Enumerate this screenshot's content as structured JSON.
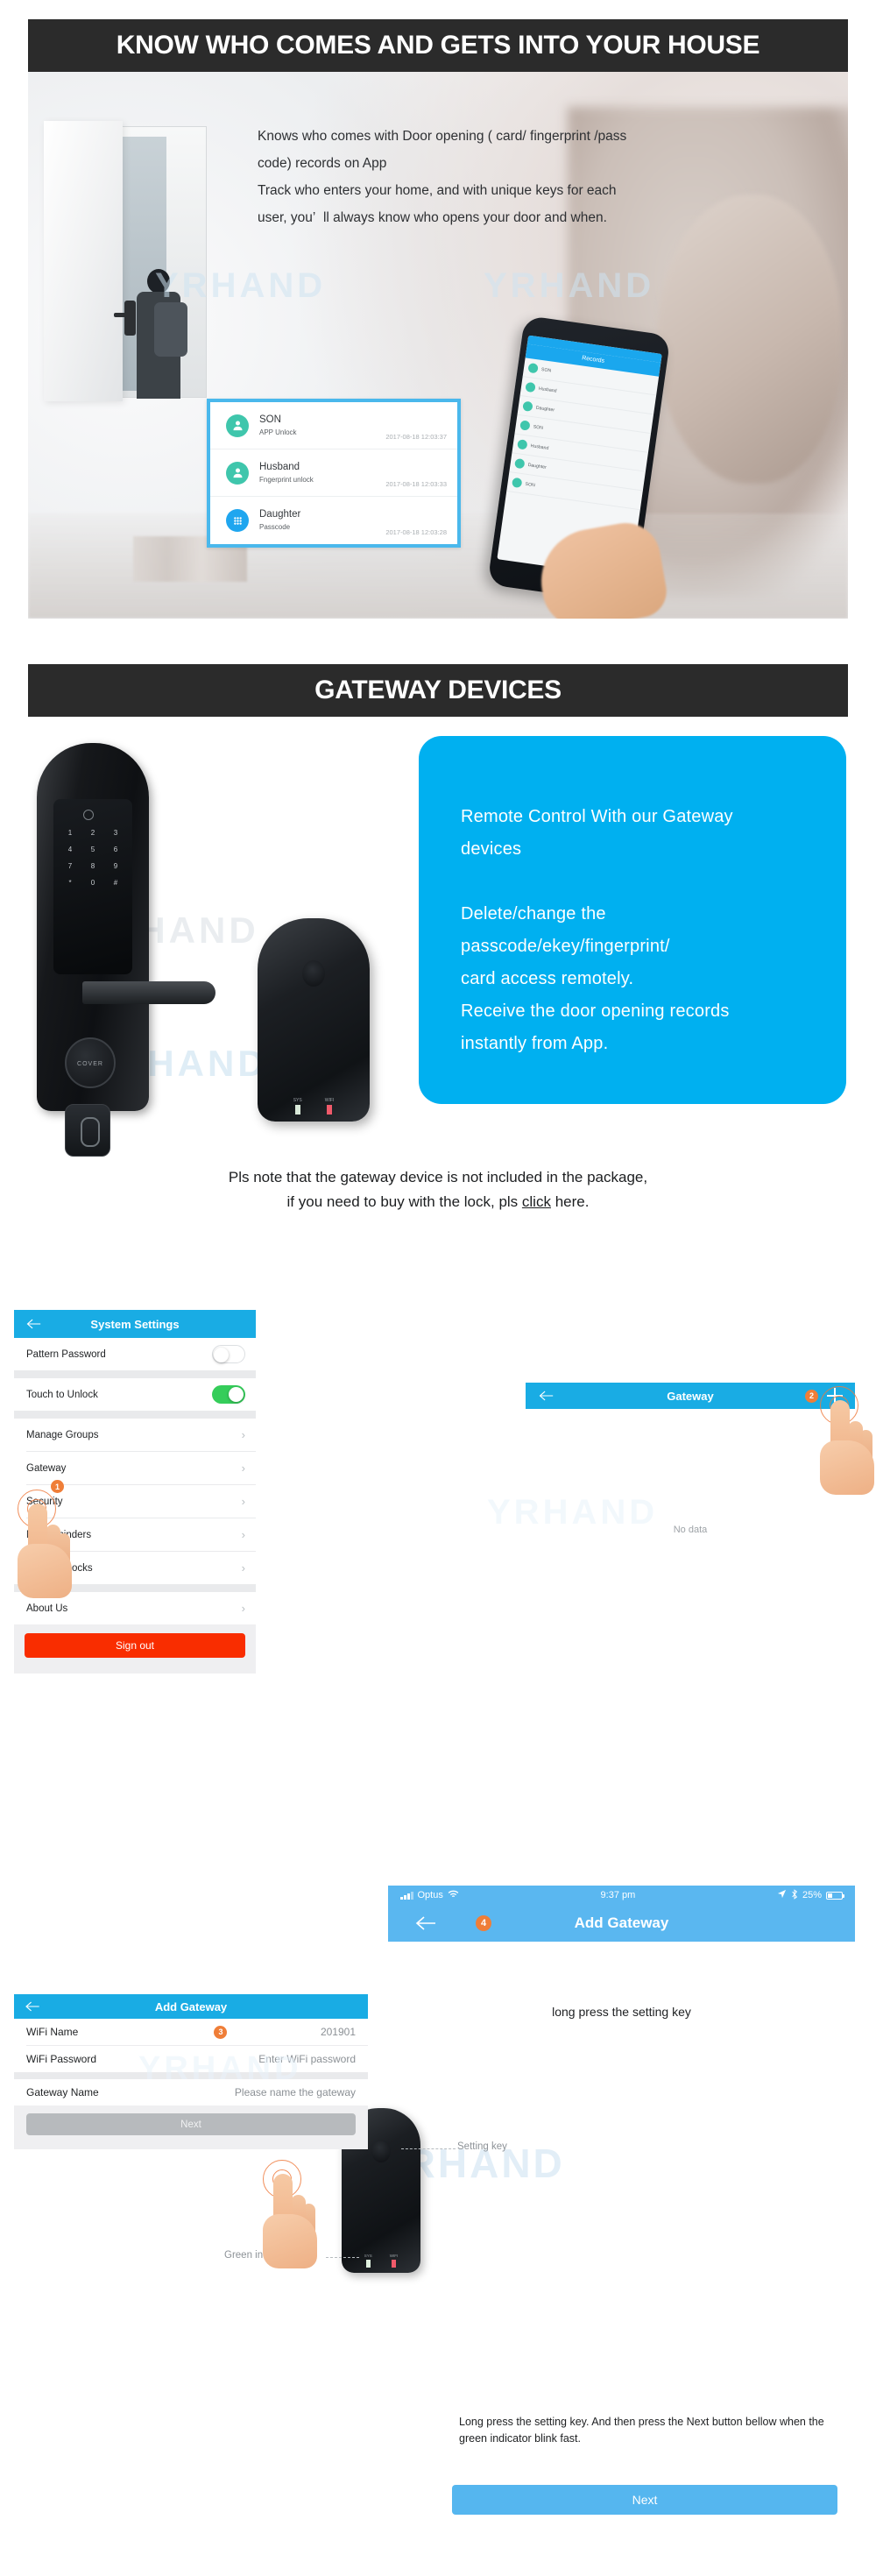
{
  "section1": {
    "banner": "KNOW WHO COMES AND GETS INTO YOUR HOUSE",
    "paragraph": "Knows who comes with Door opening ( card/ fingerprint /pass code) records on App\nTrack who enters your home, and with unique keys for each user, you’ ll always know who opens your door and when.",
    "watermark": "YRHAND",
    "records": [
      {
        "name": "SON",
        "method": "APP Unlock",
        "time": "2017-08-18 12:03:37",
        "icon": "person-icon",
        "color": "#3fc6ac"
      },
      {
        "name": "Husband",
        "method": "Fngerprint unlock",
        "time": "2017-08-18 12:03:33",
        "icon": "person-icon",
        "color": "#3fc6ac"
      },
      {
        "name": "Daughter",
        "method": "Passcode",
        "time": "2017-08-18 12:03:28",
        "icon": "keypad-icon",
        "color": "#1fa6ef"
      }
    ],
    "phone_header": "Records"
  },
  "section2": {
    "banner": "GATEWAY DEVICES",
    "blue_card": "Remote Control With our Gateway devices\n\nDelete/change the passcode/ekey/fingerprint/ card access remotely.\nReceive the door opening records instantly from App.",
    "lock_keys": [
      "1",
      "2",
      "3",
      "4",
      "5",
      "6",
      "7",
      "8",
      "9",
      "*",
      "0",
      "#"
    ],
    "lock_cover_label": "COVER",
    "gateway_leds": [
      {
        "label": "SYS",
        "color": "#d8e8d8"
      },
      {
        "label": "WIFI",
        "color": "#f05a6a"
      }
    ],
    "watermark": "YRHAND"
  },
  "note": {
    "line1": "Pls note that the gateway device is not included in the package,",
    "line2_pre": "if you need to buy with the lock, pls ",
    "link": "click",
    "line2_post": " here."
  },
  "settings_screen": {
    "title": "System Settings",
    "back_icon": "back-arrow-icon",
    "rows": [
      {
        "label": "Pattern Password",
        "control": "toggle",
        "state": "off"
      },
      {
        "label": "Touch to Unlock",
        "control": "toggle",
        "state": "on"
      },
      {
        "label": "Manage Groups",
        "control": "chevron"
      },
      {
        "label": "Gateway",
        "control": "chevron",
        "step": "1"
      },
      {
        "label": "Security",
        "control": "chevron"
      },
      {
        "label": "My Reminders",
        "control": "chevron"
      },
      {
        "label": "Transfer Locks",
        "control": "chevron"
      },
      {
        "label": "About Us",
        "control": "chevron"
      }
    ],
    "sign_out": "Sign out",
    "chevron": "›"
  },
  "gateway_screen": {
    "title": "Gateway",
    "back_icon": "back-arrow-icon",
    "add_icon": "plus-icon",
    "step": "2",
    "empty_state": "No data",
    "watermark": "YRHAND"
  },
  "add_gateway_right": {
    "statusbar": {
      "carrier": "Optus",
      "wifi_icon": "wifi-icon",
      "time": "9:37 pm",
      "location_icon": "location-arrow-icon",
      "bluetooth_icon": "bluetooth-icon",
      "battery": "25%"
    },
    "title": "Add Gateway",
    "back_icon": "back-arrow-icon",
    "step": "4"
  },
  "add_gateway_left": {
    "title": "Add Gateway",
    "back_icon": "back-arrow-icon",
    "fields": [
      {
        "label": "WiFi Name",
        "value": "201901",
        "step": "3"
      },
      {
        "label": "WiFi Password",
        "placeholder": "Enter WiFi password"
      },
      {
        "label": "Gateway Name",
        "placeholder": "Please name the gateway"
      }
    ],
    "next_label": "Next",
    "watermark": "YRHAND"
  },
  "instructions": {
    "long_press_caption": "long press the setting key",
    "setting_key_label": "Setting key",
    "green_indicator_label": "Green indicator",
    "paragraph": "Long press the setting key. And then press the Next button bellow when the green indicator blink fast.",
    "next_label": "Next",
    "watermark": "YRHAND"
  },
  "colors": {
    "banner_bg": "#2b2b2b",
    "accent_blue": "#19ace4",
    "light_blue": "#5ab7f0",
    "card_blue": "#00b0f0",
    "toggle_green": "#35cd5a",
    "signout_red": "#f92d00",
    "step_orange": "#ef7e38"
  }
}
